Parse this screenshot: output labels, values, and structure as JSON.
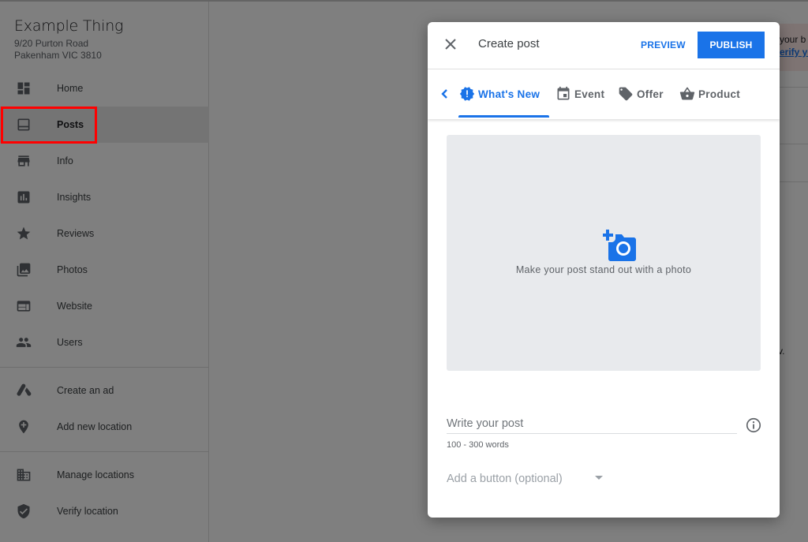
{
  "business": {
    "name": "Example Thing",
    "address_line1": "9/20 Purton Road",
    "address_line2": "Pakenham VIC 3810"
  },
  "sidebar": {
    "items": [
      {
        "label": "Home",
        "icon": "dashboard-icon",
        "active": false
      },
      {
        "label": "Posts",
        "icon": "posts-icon",
        "active": true
      },
      {
        "label": "Info",
        "icon": "storefront-icon",
        "active": false
      },
      {
        "label": "Insights",
        "icon": "bar-chart-icon",
        "active": false
      },
      {
        "label": "Reviews",
        "icon": "star-icon",
        "active": false
      },
      {
        "label": "Photos",
        "icon": "photo-library-icon",
        "active": false
      },
      {
        "label": "Website",
        "icon": "web-icon",
        "active": false
      },
      {
        "label": "Users",
        "icon": "people-icon",
        "active": false
      }
    ],
    "secondary_items": [
      {
        "label": "Create an ad",
        "icon": "google-ads-icon"
      },
      {
        "label": "Add new location",
        "icon": "add-location-icon"
      }
    ],
    "tertiary_items": [
      {
        "label": "Manage locations",
        "icon": "buildings-icon"
      },
      {
        "label": "Verify location",
        "icon": "verified-shield-icon"
      }
    ]
  },
  "background_content": {
    "banner_text": "your b",
    "banner_link": "erify yo",
    "fragment_text": "v."
  },
  "dialog": {
    "title": "Create post",
    "preview_label": "PREVIEW",
    "publish_label": "PUBLISH",
    "tabs": [
      {
        "label": "What's New",
        "icon": "announcement-icon",
        "active": true
      },
      {
        "label": "Event",
        "icon": "calendar-icon",
        "active": false
      },
      {
        "label": "Offer",
        "icon": "tag-icon",
        "active": false
      },
      {
        "label": "Product",
        "icon": "basket-icon",
        "active": false
      }
    ],
    "photo_prompt": "Make your post stand out with a photo",
    "post_input": {
      "placeholder": "Write your post",
      "value": ""
    },
    "post_hint": "100 - 300 words",
    "add_button_select": {
      "selected": "Add a button (optional)"
    }
  },
  "colors": {
    "accent": "#1a73e8",
    "highlight_box": "#ff0000",
    "overlay": "rgba(0,0,0,0.5)"
  }
}
